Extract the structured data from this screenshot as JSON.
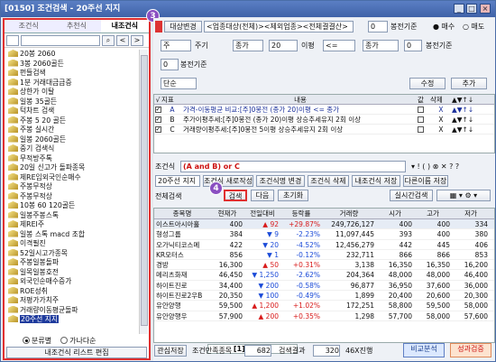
{
  "window": {
    "title": "[0150] 조건검색 - 20주선 지지"
  },
  "left": {
    "tabs": [
      "조건식",
      "추천식",
      "내조건식"
    ],
    "badge": "3",
    "items": [
      "20봉 2060",
      "3봉 2060골든",
      "펀들검색",
      "1분 거래대금급증",
      "상한가 이탈",
      "일봉 35골든",
      "턱차트 검색",
      "주봉 5 20 골든",
      "주봉 실시간",
      "일봉 2060골든",
      "중기 검색식",
      "무적방주톡",
      "20일 신고가 돌파종목",
      "제RE임외국인순매수",
      "주봉무적상",
      "주봉무적상",
      "10봉 60 120골든",
      "일봉주봉스톡",
      "제REI주",
      "일봉 스톡 macd 조합",
      "이격필진",
      "52일시고가종목",
      "주봉일봉돌파",
      "일목일봉호전",
      "외국인순매수증가",
      "ROE성취",
      "저평가가치주",
      "거래량이동평균돌파",
      "20주선 지지"
    ],
    "radio": [
      "분류별",
      "가나다순"
    ],
    "edit_button": "내조건식 리스트 편집"
  },
  "top": {
    "target_label": "대상변경",
    "target_value": "<업종대상(전체)><제외업종><전체결결산>",
    "stepper": "0",
    "basis_label": "봉전기준",
    "buy": "매수",
    "sell": "매도",
    "period": "주",
    "period_label": "주기",
    "field1": "종가",
    "num1": "20",
    "ma_label": "이평",
    "op": "<=",
    "field2": "종가",
    "num2": "0",
    "basis2": "봉전기준",
    "num3": "0",
    "basis3": "봉전기준",
    "single": "단순",
    "modify": "수정",
    "add": "추가"
  },
  "cond": {
    "headers": [
      "지표",
      "내용",
      "값",
      "삭제"
    ],
    "rows": [
      {
        "key": "A",
        "text": "가격-이동평균 비교:[주]0봉전 (종가 20)이평 <= 종가",
        "blue": true
      },
      {
        "key": "B",
        "text": "주가이평추세:[주]0봉전 (종가 20)이평 상승추세유지 2회 이상",
        "blue": false
      },
      {
        "key": "C",
        "text": "거래량이평추세:[주]0봉전 5이평 상승추세유지 2회 이상",
        "blue": false
      }
    ]
  },
  "formula": {
    "label": "조건식",
    "value": "(A and B) or C"
  },
  "actions": [
    "20주선 지지",
    "조건식 새로작성",
    "조건식명 변경",
    "조건식 삭제",
    "내조건식 저장",
    "다른이름 저장"
  ],
  "search": {
    "label": "전체검색",
    "btn": "검색",
    "next": "다음",
    "reset": "초기화",
    "realtime": "실시간검색",
    "badge": "4"
  },
  "table": {
    "headers": [
      "종목명",
      "현재가",
      "전일대비",
      "등락률",
      "거래량",
      "시가",
      "고가",
      "저가"
    ],
    "rows": [
      [
        "이스트아시아홀",
        "400",
        "▲",
        "92",
        "+29.87%",
        "249,726,127",
        "400",
        "400",
        "334"
      ],
      [
        "형성그룹",
        "384",
        "▼",
        "9",
        "-2.23%",
        "11,097,445",
        "393",
        "400",
        "380"
      ],
      [
        "오가닉티코스메",
        "422",
        "▼",
        "20",
        "-4.52%",
        "12,456,279",
        "442",
        "445",
        "406"
      ],
      [
        "KR모터스",
        "856",
        "▼",
        "1",
        "-0.12%",
        "232,711",
        "866",
        "866",
        "853"
      ],
      [
        "경방",
        "16,300",
        "▲",
        "50",
        "+0.31%",
        "3,138",
        "16,350",
        "16,350",
        "16,200"
      ],
      [
        "메리츠화재",
        "46,450",
        "▼",
        "1,250",
        "-2.62%",
        "204,364",
        "48,000",
        "48,000",
        "46,400"
      ],
      [
        "하이트진로",
        "34,400",
        "▼",
        "200",
        "-0.58%",
        "96,877",
        "36,950",
        "37,600",
        "36,000"
      ],
      [
        "하이트진로2우B",
        "20,350",
        "▼",
        "100",
        "-0.49%",
        "1,899",
        "20,400",
        "20,600",
        "20,300"
      ],
      [
        "유안양행",
        "59,500",
        "▲",
        "1,200",
        "+1.02%",
        "172,251",
        "58,800",
        "59,500",
        "58,000"
      ],
      [
        "유안양행우",
        "57,900",
        "▲",
        "200",
        "+0.35%",
        "1,298",
        "57,700",
        "58,000",
        "57,600"
      ]
    ],
    "bottom_tab": "[1]전체검색"
  },
  "statusbar": {
    "save": "관심저장",
    "count_label": "조건만족종목",
    "count": "682",
    "result_label": "검색결과",
    "result": "320",
    "zoom": "46X진행",
    "compare": "비교분석",
    "perf": "성과검증"
  }
}
